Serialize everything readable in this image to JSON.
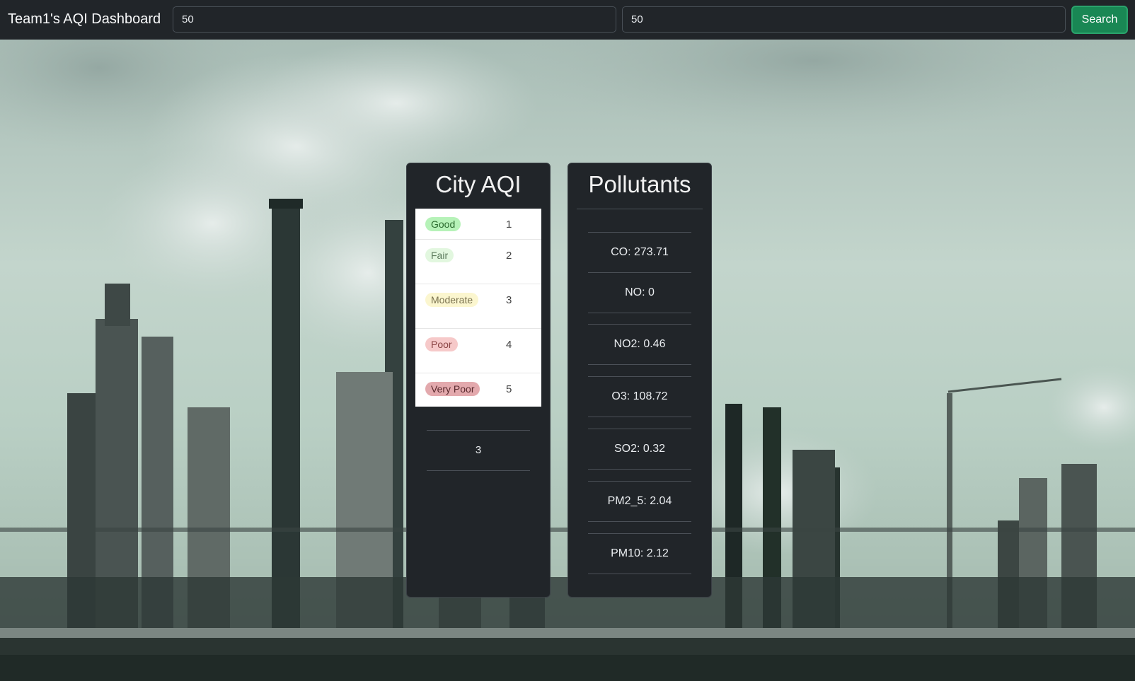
{
  "navbar": {
    "brand": "Team1's AQI Dashboard",
    "lat_value": "50",
    "lon_value": "50",
    "search_label": "Search"
  },
  "aqi_card": {
    "title": "City AQI",
    "scale": [
      {
        "label": "Good",
        "value": "1",
        "color": "#b6f2b8"
      },
      {
        "label": "Fair",
        "value": "2",
        "color": "#e2f7df"
      },
      {
        "label": "Moderate",
        "value": "3",
        "color": "#fbf6cf"
      },
      {
        "label": "Poor",
        "value": "4",
        "color": "#f6c9c9"
      },
      {
        "label": "Very Poor",
        "value": "5",
        "color": "#e3a9ad"
      }
    ],
    "current_value": "3"
  },
  "pollutants_card": {
    "title": "Pollutants",
    "items": [
      "CO: 273.71",
      "NO: 0",
      "NO2: 0.46",
      "O3: 108.72",
      "SO2: 0.32",
      "PM2_5: 2.04",
      "PM10: 2.12"
    ]
  }
}
